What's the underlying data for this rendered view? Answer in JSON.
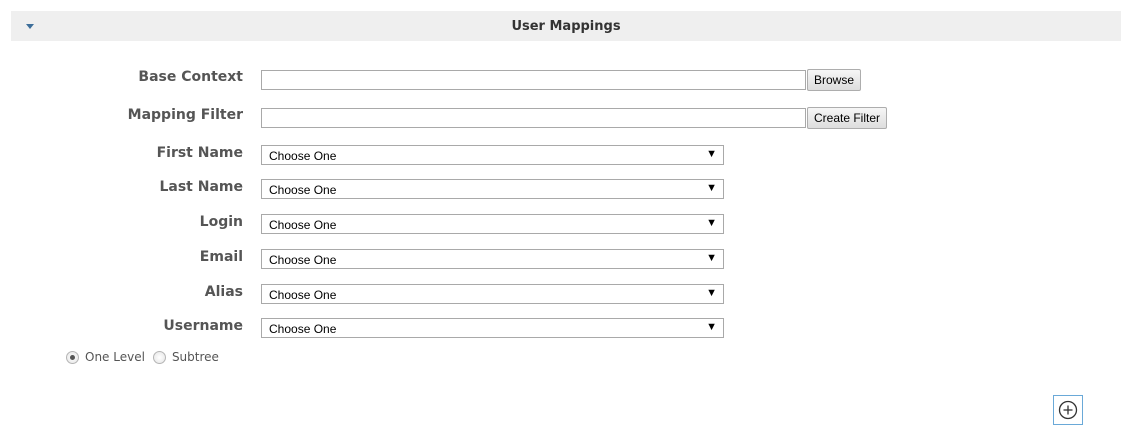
{
  "section": {
    "title": "User Mappings"
  },
  "fields": {
    "base_context": {
      "label": "Base Context",
      "value": "",
      "button": "Browse"
    },
    "mapping_filter": {
      "label": "Mapping Filter",
      "value": "",
      "button": "Create Filter"
    },
    "first_name": {
      "label": "First Name",
      "selected": "Choose One"
    },
    "last_name": {
      "label": "Last Name",
      "selected": "Choose One"
    },
    "login": {
      "label": "Login",
      "selected": "Choose One"
    },
    "email": {
      "label": "Email",
      "selected": "Choose One"
    },
    "alias": {
      "label": "Alias",
      "selected": "Choose One"
    },
    "username": {
      "label": "Username",
      "selected": "Choose One"
    }
  },
  "scope": {
    "options": [
      {
        "label": "One Level",
        "checked": true
      },
      {
        "label": "Subtree",
        "checked": false
      }
    ]
  },
  "icons": {
    "collapse": "triangle-down-icon",
    "select_arrow": "dropdown-arrow-icon",
    "add": "plus-circle-icon"
  },
  "colors": {
    "accent": "#3d6e9a",
    "header_bg": "#efefef",
    "add_border": "#6aa9d8"
  }
}
